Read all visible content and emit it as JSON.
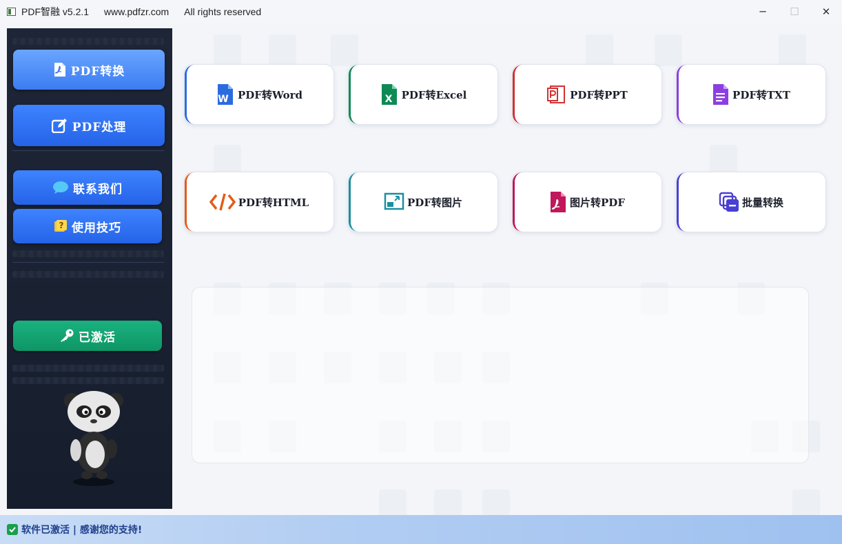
{
  "window": {
    "title": "PDF智融 v5.2.1",
    "website": "www.pdfzr.com",
    "rights": "All rights reserved",
    "minimize": "─",
    "maximize": "☐",
    "close": "✕"
  },
  "sidebar": {
    "convert_label": "PDF转换",
    "process_label": "PDF处理",
    "contact_label": "联系我们",
    "tips_label": "使用技巧",
    "activated_label": "已激活"
  },
  "tools": [
    {
      "label": "PDF转Word",
      "icon": "word-icon",
      "accent": "#2b6be0"
    },
    {
      "label": "PDF转Excel",
      "icon": "excel-icon",
      "accent": "#0f8a55"
    },
    {
      "label": "PDF转PPT",
      "icon": "ppt-icon",
      "accent": "#d33030"
    },
    {
      "label": "PDF转TXT",
      "icon": "txt-icon",
      "accent": "#8b3fe0"
    },
    {
      "label": "PDF转HTML",
      "icon": "html-icon",
      "accent": "#e45b18"
    },
    {
      "label": "PDF转图片",
      "icon": "image-icon",
      "accent": "#1a8fa0"
    },
    {
      "label": "图片转PDF",
      "icon": "pdf-icon",
      "accent": "#c0185a"
    },
    {
      "label": "批量转换",
      "icon": "batch-icon",
      "accent": "#4a3fd0"
    }
  ],
  "status": {
    "text": "软件已激活 | 感谢您的支持!"
  }
}
